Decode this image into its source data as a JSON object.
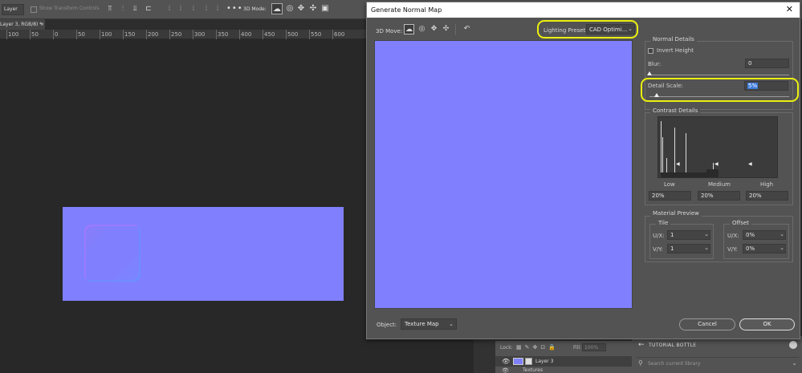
{
  "options_bar": {
    "tool_select": "Layer",
    "show_transform_controls": "Show Transform Controls",
    "more": "•••",
    "mode_label": "3D Mode:"
  },
  "document": {
    "tab_title": "Layer 3, RGB/8) *",
    "tab_close": "×",
    "ruler_ticks": [
      "100",
      "50",
      "0",
      "50",
      "100",
      "150",
      "200",
      "250",
      "300",
      "350",
      "400",
      "450",
      "500",
      "550",
      "600"
    ]
  },
  "layers_panel": {
    "lock_label": "Lock:",
    "fill_label": "Fill:",
    "fill_value": "100%",
    "layer_name": "Layer 3",
    "sub_item": "Textures"
  },
  "library_panel": {
    "title": "TUTORIAL BOTTLE",
    "search_placeholder": "Search current library"
  },
  "dialog": {
    "title": "Generate Normal Map",
    "close": "✕",
    "move_label": "3D Move:",
    "lighting_preset_label": "Lighting Preset:",
    "lighting_preset_value": "CAD Optimi...",
    "object_label": "Object:",
    "object_value": "Texture Map",
    "cancel_label": "Cancel",
    "ok_label": "OK",
    "normal_details": {
      "title": "Normal Details",
      "invert_height_label": "Invert Height",
      "blur_label": "Blur:",
      "blur_value": "0",
      "detail_scale_label": "Detail Scale:",
      "detail_scale_value": "5%"
    },
    "contrast_details": {
      "title": "Contrast Details",
      "low_label": "Low",
      "medium_label": "Medium",
      "high_label": "High",
      "low_value": "20%",
      "medium_value": "20%",
      "high_value": "20%"
    },
    "material_preview": {
      "title": "Material Preview",
      "tile_title": "Tile",
      "offset_title": "Offset",
      "tile_ux_label": "U/X:",
      "tile_ux_value": "1",
      "tile_vy_label": "V/Y:",
      "tile_vy_value": "1",
      "offset_ux_label": "U/X:",
      "offset_ux_value": "0%",
      "offset_vy_label": "V/Y:",
      "offset_vy_value": "0%"
    }
  },
  "colors": {
    "normal_map_blue": "#8080fe",
    "highlight_yellow": "#ebf00f",
    "selection_blue": "#3c79d9"
  }
}
